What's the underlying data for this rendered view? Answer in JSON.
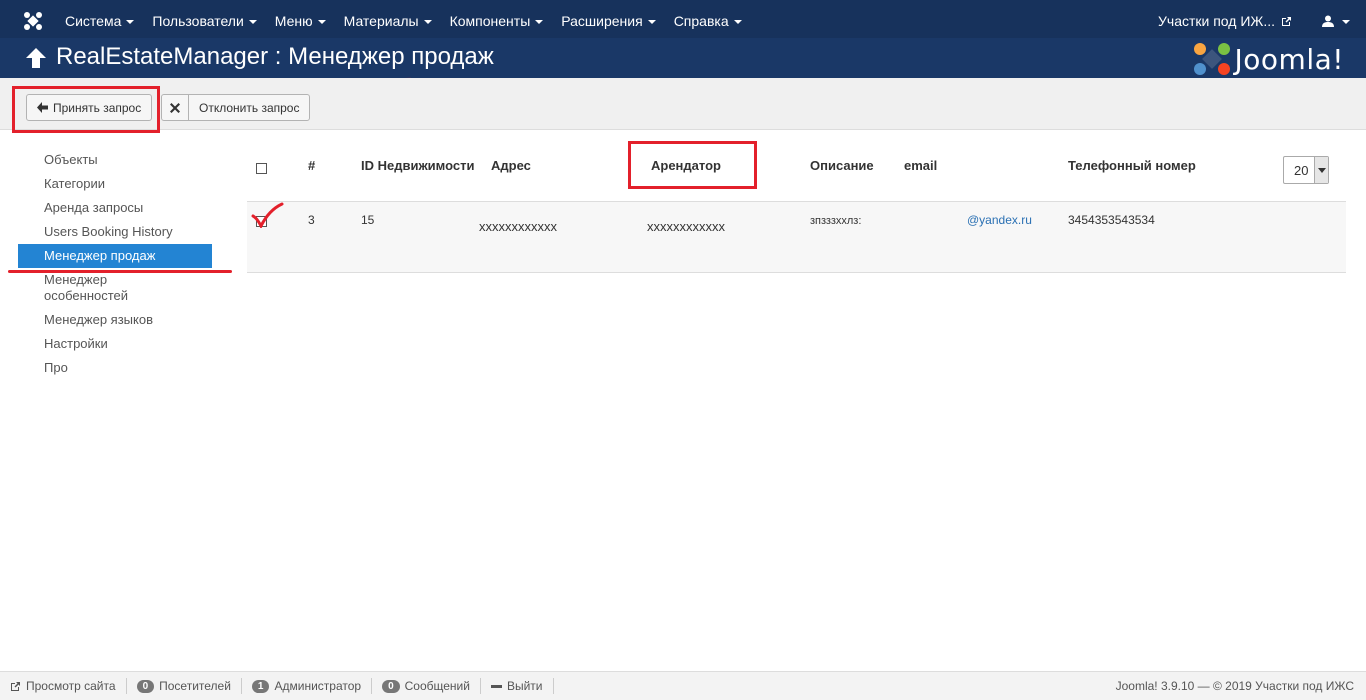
{
  "navbar": {
    "menu": [
      {
        "label": "Система"
      },
      {
        "label": "Пользователи"
      },
      {
        "label": "Меню"
      },
      {
        "label": "Материалы"
      },
      {
        "label": "Компоненты"
      },
      {
        "label": "Расширения"
      },
      {
        "label": "Справка"
      }
    ],
    "site_link": "Участки под ИЖ...",
    "user_icon": "user-icon"
  },
  "title": {
    "text": "RealEstateManager : Менеджер продаж",
    "brand": "Joomla!"
  },
  "toolbar": {
    "accept_label": "Принять запрос",
    "reject_label": "Отклонить запрос"
  },
  "sidebar": {
    "items": [
      {
        "label": "Объекты"
      },
      {
        "label": "Категории"
      },
      {
        "label": "Аренда запросы"
      },
      {
        "label": "Users Booking History"
      },
      {
        "label": "Менеджер продаж",
        "active": true
      },
      {
        "label": "Менеджер особенностей"
      },
      {
        "label": "Менеджер языков"
      },
      {
        "label": "Настройки"
      },
      {
        "label": "Про"
      }
    ]
  },
  "table": {
    "headers": {
      "num": "#",
      "id": "ID Недвижимости",
      "address": "Адрес",
      "renter": "Арендатор",
      "description": "Описание",
      "email": "email",
      "phone": "Телефонный номер"
    },
    "limit": "20",
    "rows": [
      {
        "num": "3",
        "id": "15",
        "address": "xxxxxxxxxxxx",
        "renter": "xxxxxxxxxxxx",
        "description": "зпзззхxлз:",
        "email": "@yandex.ru",
        "phone": "3454353543534"
      }
    ]
  },
  "footer": {
    "view_site": "Просмотр сайта",
    "visitors_count": "0",
    "visitors_label": "Посетителей",
    "admins_count": "1",
    "admins_label": "Администратор",
    "messages_count": "0",
    "messages_label": "Сообщений",
    "logout": "Выйти",
    "copyright": "Joomla! 3.9.10 — © 2019 Участки под ИЖС"
  },
  "colors": {
    "navbar": "#17325c",
    "titlebar": "#1a3867",
    "active_item": "#2384d3",
    "annotation": "#e3202b"
  }
}
